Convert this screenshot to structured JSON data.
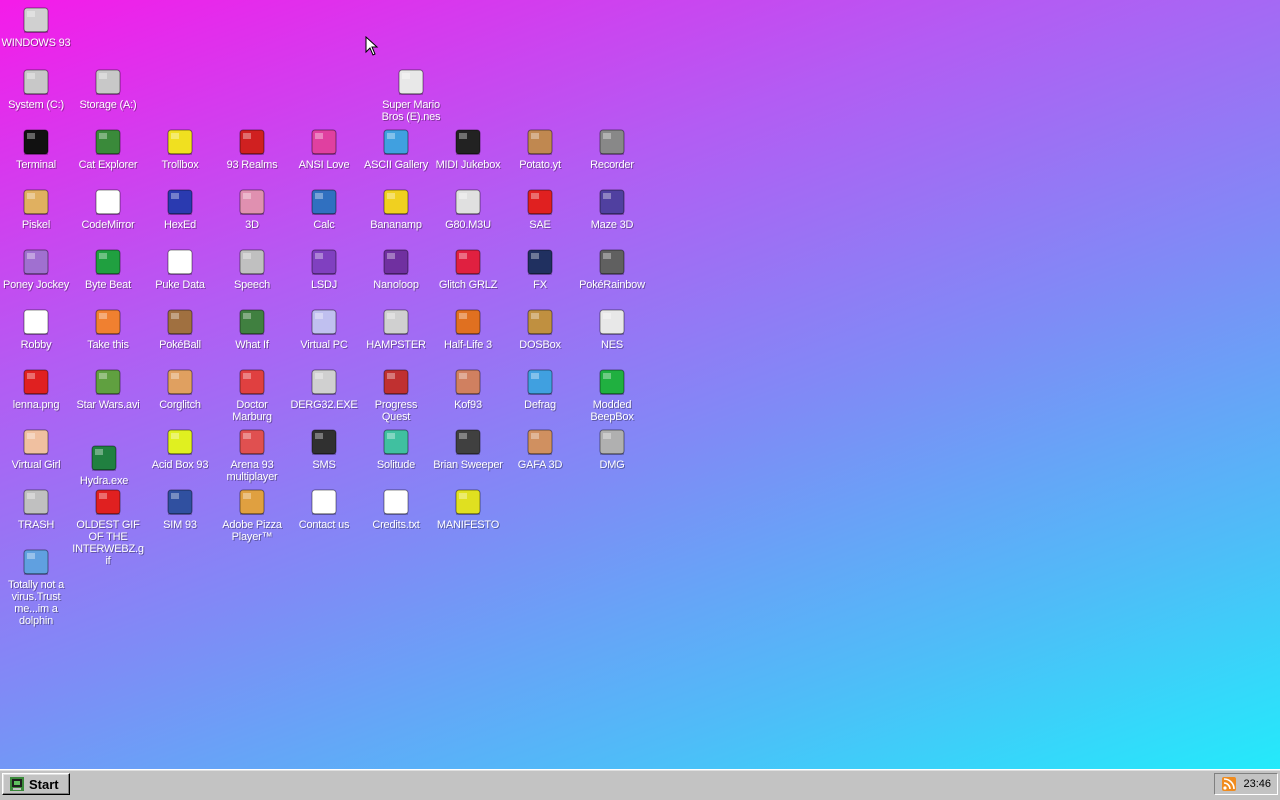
{
  "desktop": {
    "icons": [
      {
        "label": "WINDOWS 93",
        "icon": "computer-icon",
        "color": "#d0d0d0"
      },
      {
        "label": "System (C:)",
        "icon": "hard-drive-icon",
        "color": "#c8c8c8"
      },
      {
        "label": "Storage (A:)",
        "icon": "floppy-drive-icon",
        "color": "#c8c8c8"
      },
      {
        "label": "Super Mario Bros (E).nes",
        "icon": "nes-cartridge-icon",
        "color": "#e8e8e8"
      },
      {
        "label": "Terminal",
        "icon": "terminal-icon",
        "color": "#111111"
      },
      {
        "label": "Cat Explorer",
        "icon": "cat-globe-icon",
        "color": "#3a8a3a"
      },
      {
        "label": "Trollbox",
        "icon": "trollbox-icon",
        "color": "#f0e020"
      },
      {
        "label": "93 Realms",
        "icon": "red-knight-icon",
        "color": "#d02020"
      },
      {
        "label": "ANSI Love",
        "icon": "ansi-letter-icon",
        "color": "#e040a0"
      },
      {
        "label": "ASCII Gallery",
        "icon": "ascii-123-icon",
        "color": "#40a0e0"
      },
      {
        "label": "MIDI Jukebox",
        "icon": "piano-keys-icon",
        "color": "#222222"
      },
      {
        "label": "Potato.yt",
        "icon": "potato-icon",
        "color": "#c08850"
      },
      {
        "label": "Recorder",
        "icon": "microphone-icon",
        "color": "#888888"
      },
      {
        "label": "Piskel",
        "icon": "palette-icon",
        "color": "#e0b060"
      },
      {
        "label": "CodeMirror",
        "icon": "codemirror-icon",
        "color": "#ffffff"
      },
      {
        "label": "HexEd",
        "icon": "hex-cube-icon",
        "color": "#2a3ab0"
      },
      {
        "label": "3D",
        "icon": "teapot-icon",
        "color": "#e090b0"
      },
      {
        "label": "Calc",
        "icon": "calculator-icon",
        "color": "#3070c0"
      },
      {
        "label": "Bananamp",
        "icon": "banana-icon",
        "color": "#f0d020"
      },
      {
        "label": "G80.M3U",
        "icon": "audio-file-icon",
        "color": "#e0e0e0"
      },
      {
        "label": "SAE",
        "icon": "checkered-ball-icon",
        "color": "#e02020"
      },
      {
        "label": "Maze 3D",
        "icon": "maze-icon",
        "color": "#5040a0"
      },
      {
        "label": "Poney Jockey",
        "icon": "pony-icon",
        "color": "#a070d0"
      },
      {
        "label": "Byte Beat",
        "icon": "bytebeat-icon",
        "color": "#20a040"
      },
      {
        "label": "Puke Data",
        "icon": "pd-icon",
        "color": "#ffffff"
      },
      {
        "label": "Speech",
        "icon": "speech-face-icon",
        "color": "#c0c0c0"
      },
      {
        "label": "LSDJ",
        "icon": "lsdj-icon",
        "color": "#8040c0"
      },
      {
        "label": "Nanoloop",
        "icon": "nanoloop-icon",
        "color": "#7030a0"
      },
      {
        "label": "Glitch GRLZ",
        "icon": "lips-icon",
        "color": "#e02040"
      },
      {
        "label": "FX",
        "icon": "fx-star-icon",
        "color": "#203060"
      },
      {
        "label": "PokéRainbow",
        "icon": "pokerainbow-icon",
        "color": "#606060"
      },
      {
        "label": "Robby",
        "icon": "robot-figure-icon",
        "color": "#ffffff"
      },
      {
        "label": "Take this",
        "icon": "take-this-icon",
        "color": "#f08030"
      },
      {
        "label": "PokéBall",
        "icon": "poke-bag-icon",
        "color": "#a07040"
      },
      {
        "label": "What If",
        "icon": "whatif-icon",
        "color": "#408040"
      },
      {
        "label": "Virtual PC",
        "icon": "virtual-pc-icon",
        "color": "#c0c0f0"
      },
      {
        "label": "HAMPSTER",
        "icon": "hamster-icon",
        "color": "#d0d0d0"
      },
      {
        "label": "Half-Life 3",
        "icon": "half-life-icon",
        "color": "#e07020"
      },
      {
        "label": "DOSBox",
        "icon": "dosbox-icon",
        "color": "#c09040"
      },
      {
        "label": "NES",
        "icon": "nes-console-icon",
        "color": "#e8e8e8"
      },
      {
        "label": "lenna.png",
        "icon": "image-file-icon",
        "color": "#e02020"
      },
      {
        "label": "Star Wars.avi",
        "icon": "yoda-icon",
        "color": "#60a040"
      },
      {
        "label": "Corglitch",
        "icon": "corgi-icon",
        "color": "#e0a060"
      },
      {
        "label": "Doctor Marburg",
        "icon": "doctor-icon",
        "color": "#e04040"
      },
      {
        "label": "DERG32.EXE",
        "icon": "derg-icon",
        "color": "#d0d0d0"
      },
      {
        "label": "Progress Quest",
        "icon": "swords-icon",
        "color": "#c03030"
      },
      {
        "label": "Kof93",
        "icon": "fighter-icon",
        "color": "#d08060"
      },
      {
        "label": "Defrag",
        "icon": "defrag-icon",
        "color": "#40a0e0"
      },
      {
        "label": "Modded BeepBox",
        "icon": "green-ring-icon",
        "color": "#20b040"
      },
      {
        "label": "Virtual Girl",
        "icon": "girl-face-icon",
        "color": "#f0c0a0"
      },
      {
        "label": "Hydra.exe",
        "icon": "hydra-icon",
        "color": "#208040"
      },
      {
        "label": "Acid Box 93",
        "icon": "smiley-icon",
        "color": "#e0f020"
      },
      {
        "label": "Arena 93 multiplayer",
        "icon": "arena-cube-icon",
        "color": "#e05050"
      },
      {
        "label": "SMS",
        "icon": "sms-console-icon",
        "color": "#303030"
      },
      {
        "label": "Solitude",
        "icon": "bottle-icon",
        "color": "#40c0a0"
      },
      {
        "label": "Brian Sweeper",
        "icon": "mine-icon",
        "color": "#404040"
      },
      {
        "label": "GAFA 3D",
        "icon": "doom-face-icon",
        "color": "#d09060"
      },
      {
        "label": "DMG",
        "icon": "dmg-icon",
        "color": "#b0b0b0"
      },
      {
        "label": "TRASH",
        "icon": "trash-icon",
        "color": "#c0c0c0"
      },
      {
        "label": "OLDEST GIF OF THE INTERWEBZ.gif",
        "icon": "gif-file-icon",
        "color": "#e02020"
      },
      {
        "label": "SIM 93",
        "icon": "sim-book-icon",
        "color": "#3050a0"
      },
      {
        "label": "Adobe Pizza Player™",
        "icon": "pizza-icon",
        "color": "#e0a040"
      },
      {
        "label": "Contact us",
        "icon": "contact-icon",
        "color": "#ffffff"
      },
      {
        "label": "Credits.txt",
        "icon": "text-file-icon",
        "color": "#ffffff"
      },
      {
        "label": "MANIFESTO",
        "icon": "question-mark-icon",
        "color": "#e0e020"
      },
      {
        "label": "Totally not a virus.Trust me...im a dolphin",
        "icon": "dolphin-icon",
        "color": "#60a0e0"
      }
    ]
  },
  "taskbar": {
    "start_label": "Start",
    "clock": "23:46",
    "rss_icon": "rss-icon"
  }
}
